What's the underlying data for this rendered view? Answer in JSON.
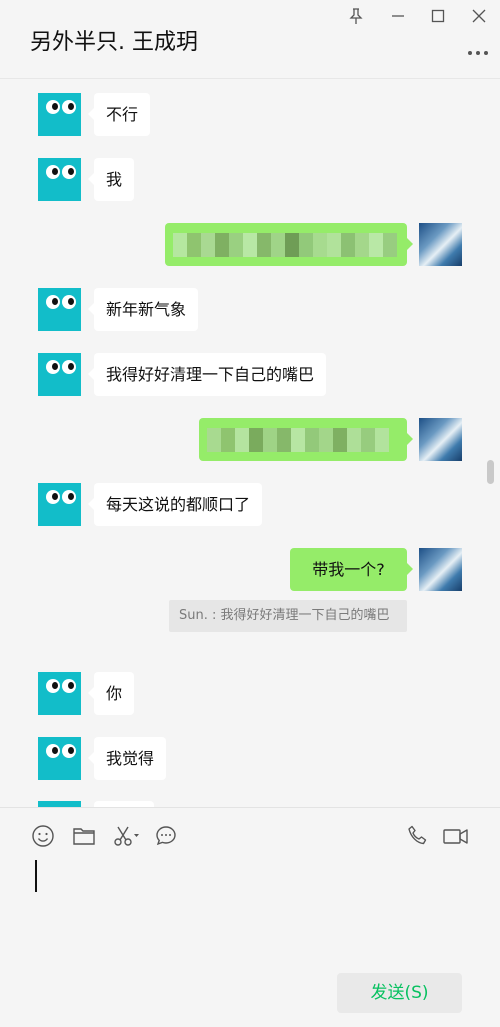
{
  "window": {
    "title": "另外半只. 王成玥",
    "pin_icon": "pin-icon",
    "minimize_icon": "minimize-icon",
    "maximize_icon": "maximize-icon",
    "close_icon": "close-icon",
    "more_icon": "more-icon"
  },
  "messages": [
    {
      "side": "left",
      "text": "不行"
    },
    {
      "side": "left",
      "text": "我"
    },
    {
      "side": "right",
      "text": "",
      "blurred": true
    },
    {
      "side": "left",
      "text": "新年新气象"
    },
    {
      "side": "left",
      "text": "我得好好清理一下自己的嘴巴"
    },
    {
      "side": "right",
      "text": "",
      "blurred": true
    },
    {
      "side": "left",
      "text": "每天这说的都顺口了"
    },
    {
      "side": "right",
      "text": "带我一个?"
    },
    {
      "side": "left",
      "text": "你"
    },
    {
      "side": "left",
      "text": "我觉得"
    }
  ],
  "quote": {
    "text": "Sun. : 我得好好清理一下自己的嘴巴"
  },
  "toolbar": {
    "emoji_icon": "emoji-icon",
    "folder_icon": "folder-icon",
    "scissors_icon": "scissors-icon",
    "chat_history_icon": "chat-history-icon",
    "voice_call_icon": "phone-icon",
    "video_call_icon": "video-call-icon"
  },
  "input": {
    "value": ""
  },
  "send_button": {
    "label": "发送(S)"
  },
  "colors": {
    "accent_green": "#07c160",
    "self_bubble": "#95ec69",
    "friend_bubble": "#ffffff",
    "friend_avatar": "#12bdc9",
    "background": "#f5f5f5"
  }
}
